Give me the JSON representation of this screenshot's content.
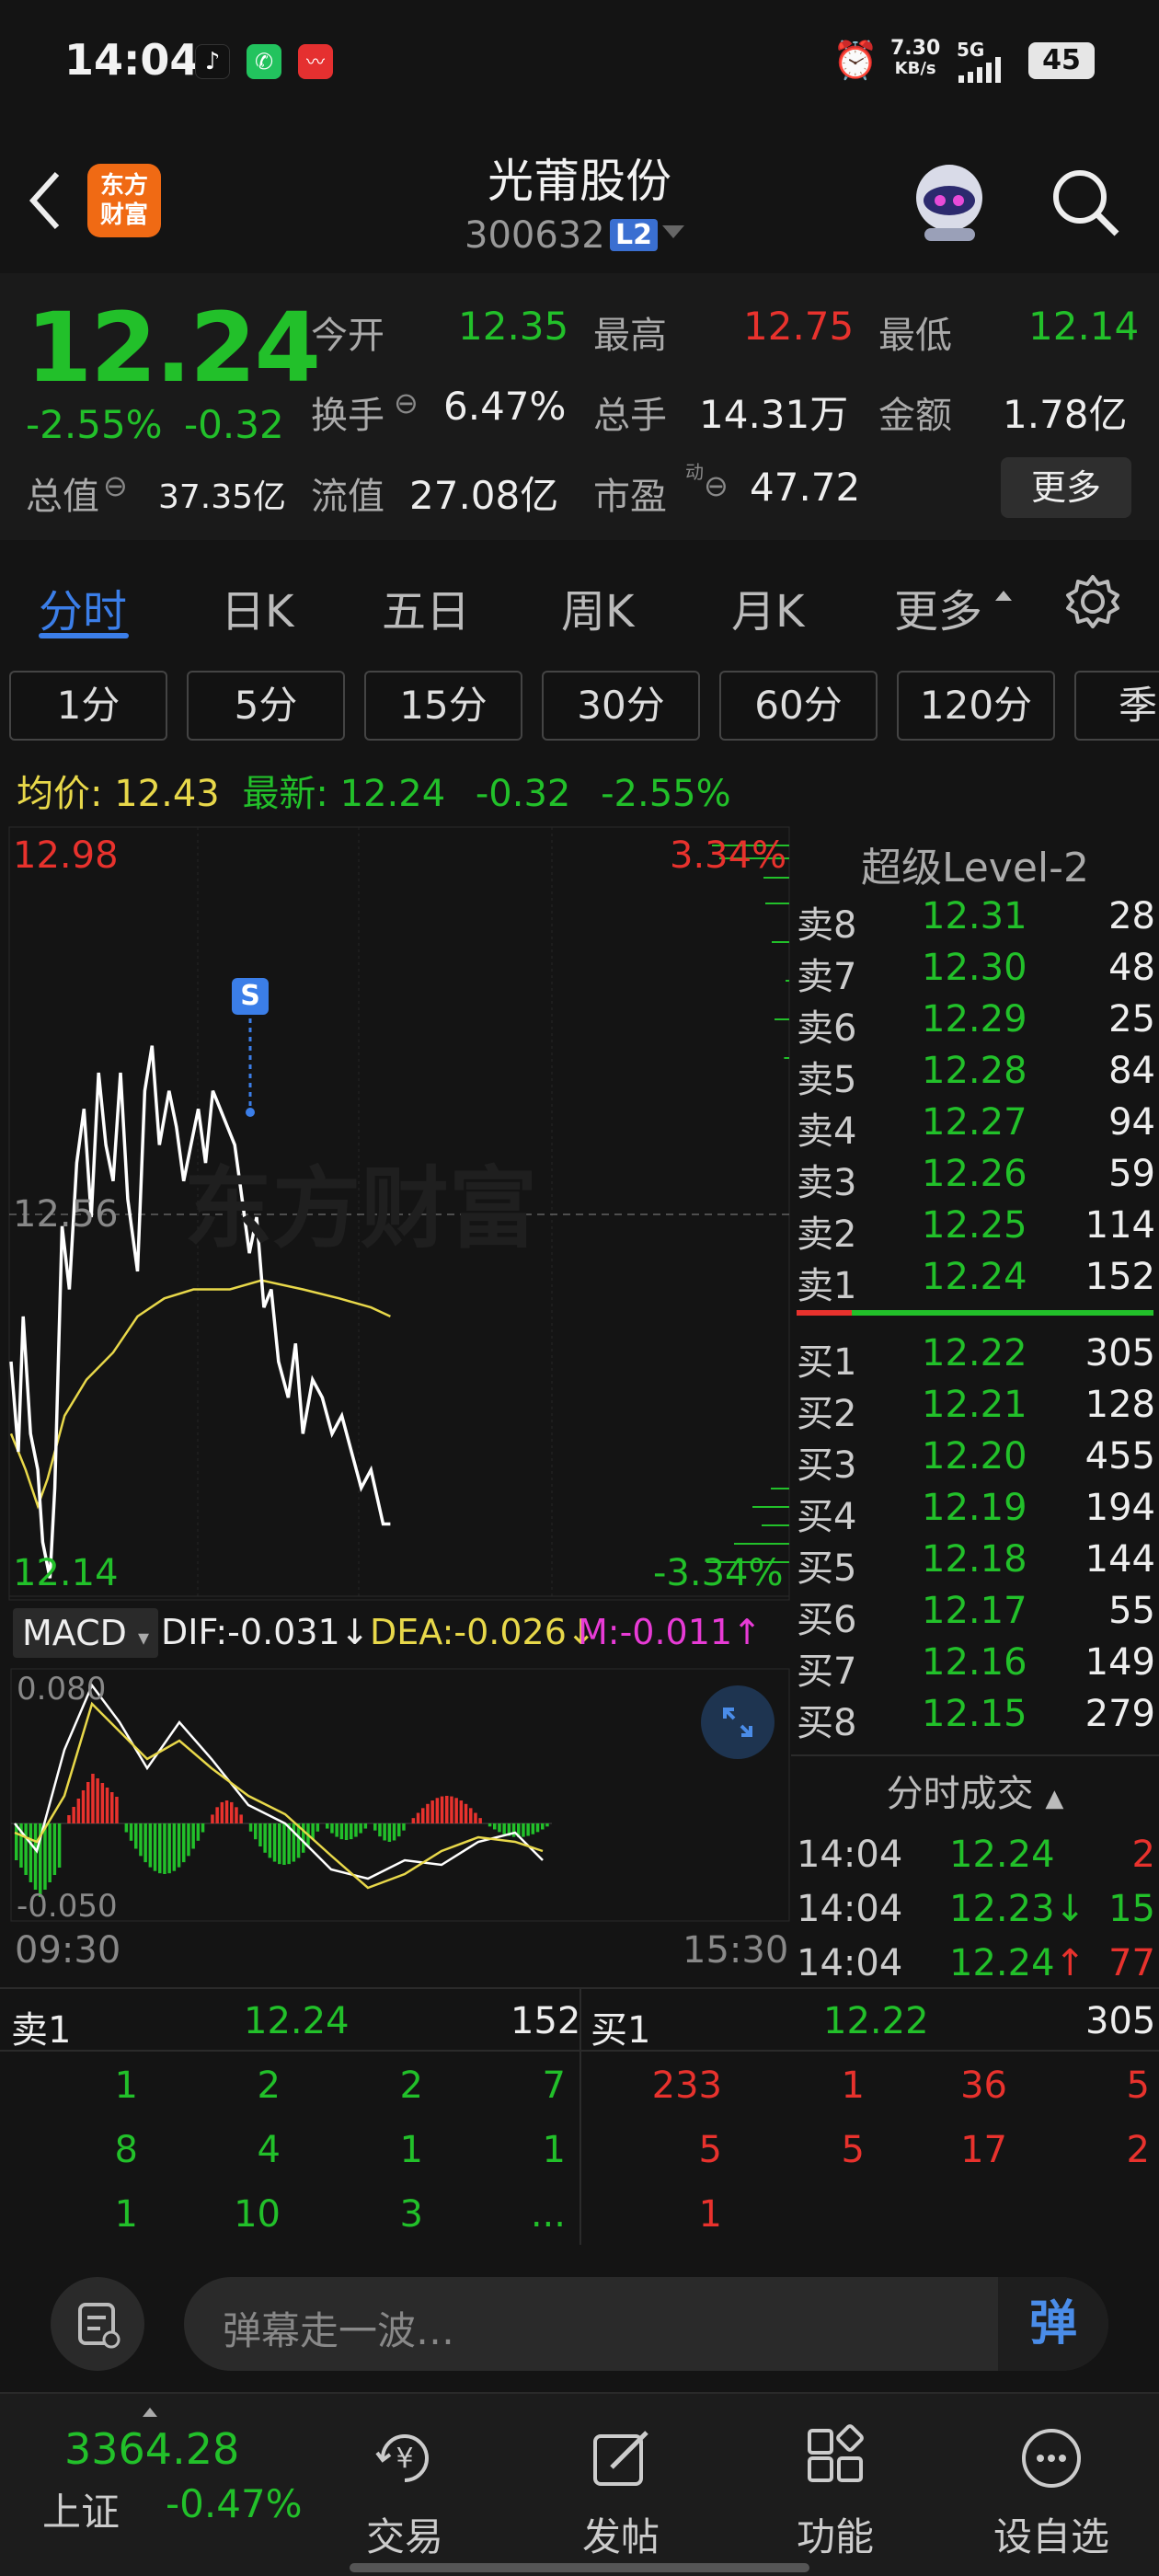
{
  "status": {
    "time": "14:04",
    "net_speed": "7.30",
    "net_unit": "KB/s",
    "signal": "5G",
    "battery": "45"
  },
  "header": {
    "title": "光莆股份",
    "code": "300632",
    "badge": "L2",
    "logo_line1": "东方",
    "logo_line2": "财富"
  },
  "quote": {
    "price": "12.24",
    "pct": "-2.55%",
    "chg": "-0.32",
    "open_label": "今开",
    "open": "12.35",
    "high_label": "最高",
    "high": "12.75",
    "low_label": "最低",
    "low": "12.14",
    "turnover_label": "换手",
    "turnover": "6.47%",
    "volume_label": "总手",
    "volume": "14.31万",
    "amount_label": "金额",
    "amount": "1.78亿",
    "mktcap_label": "总值",
    "mktcap": "37.35亿",
    "float_label": "流值",
    "float": "27.08亿",
    "pe_label": "市盈",
    "pe_sup": "动",
    "pe": "47.72",
    "more": "更多"
  },
  "tabs": [
    "分时",
    "日K",
    "五日",
    "周K",
    "月K",
    "更多"
  ],
  "periods": [
    "1分",
    "5分",
    "15分",
    "30分",
    "60分",
    "120分",
    "季"
  ],
  "avg": {
    "label": "均价:",
    "value": "12.43",
    "latest_label": "最新:",
    "latest": "12.24",
    "chg": "-0.32",
    "pct": "-2.55%"
  },
  "chart": {
    "ymax": "12.98",
    "ymid": "12.56",
    "ymin": "12.14",
    "pmax": "3.34%",
    "pmin": "-3.34%",
    "watermark": "东方财富",
    "marker": "S",
    "t_start": "09:30",
    "t_end": "15:30"
  },
  "macd": {
    "label": "MACD",
    "dif": "DIF:-0.031",
    "dea": "DEA:-0.026",
    "m": "M:-0.011",
    "top": "0.080",
    "bottom": "-0.050"
  },
  "level2": {
    "title": "超级Level-2",
    "asks": [
      {
        "l": "卖8",
        "p": "12.31",
        "v": "28"
      },
      {
        "l": "卖7",
        "p": "12.30",
        "v": "48"
      },
      {
        "l": "卖6",
        "p": "12.29",
        "v": "25"
      },
      {
        "l": "卖5",
        "p": "12.28",
        "v": "84"
      },
      {
        "l": "卖4",
        "p": "12.27",
        "v": "94"
      },
      {
        "l": "卖3",
        "p": "12.26",
        "v": "59"
      },
      {
        "l": "卖2",
        "p": "12.25",
        "v": "114"
      },
      {
        "l": "卖1",
        "p": "12.24",
        "v": "152"
      }
    ],
    "bids": [
      {
        "l": "买1",
        "p": "12.22",
        "v": "305"
      },
      {
        "l": "买2",
        "p": "12.21",
        "v": "128"
      },
      {
        "l": "买3",
        "p": "12.20",
        "v": "455"
      },
      {
        "l": "买4",
        "p": "12.19",
        "v": "194"
      },
      {
        "l": "买5",
        "p": "12.18",
        "v": "144"
      },
      {
        "l": "买6",
        "p": "12.17",
        "v": "55"
      },
      {
        "l": "买7",
        "p": "12.16",
        "v": "149"
      },
      {
        "l": "买8",
        "p": "12.15",
        "v": "279"
      }
    ],
    "trades_title": "分时成交",
    "trades": [
      {
        "t": "14:04",
        "p": "12.24",
        "v": "2",
        "arrow": ""
      },
      {
        "t": "14:04",
        "p": "12.23",
        "v": "15",
        "arrow": "↓"
      },
      {
        "t": "14:04",
        "p": "12.24",
        "v": "77",
        "arrow": "↑"
      }
    ]
  },
  "queue": {
    "sell_label": "卖1",
    "sell_price": "12.24",
    "sell_vol": "152",
    "buy_label": "买1",
    "buy_price": "12.22",
    "buy_vol": "305",
    "sell_rows": [
      [
        "1",
        "2",
        "2",
        "7"
      ],
      [
        "8",
        "4",
        "1",
        "1"
      ],
      [
        "1",
        "10",
        "3",
        "..."
      ]
    ],
    "buy_rows": [
      [
        "233",
        "1",
        "36",
        "5"
      ],
      [
        "5",
        "5",
        "17",
        "2"
      ],
      [
        "1",
        "",
        "",
        ""
      ]
    ]
  },
  "danmu": {
    "placeholder": "弹幕走一波…",
    "btn": "弹"
  },
  "bottom": {
    "index_value": "3364.28",
    "index_name": "上证",
    "index_pct": "-0.47%",
    "items": [
      "交易",
      "发帖",
      "功能",
      "设自选"
    ]
  },
  "colors": {
    "up": "#e8322d",
    "down": "#22c02a",
    "price_line": "#ffffff",
    "avg_line": "#e8d84a"
  }
}
